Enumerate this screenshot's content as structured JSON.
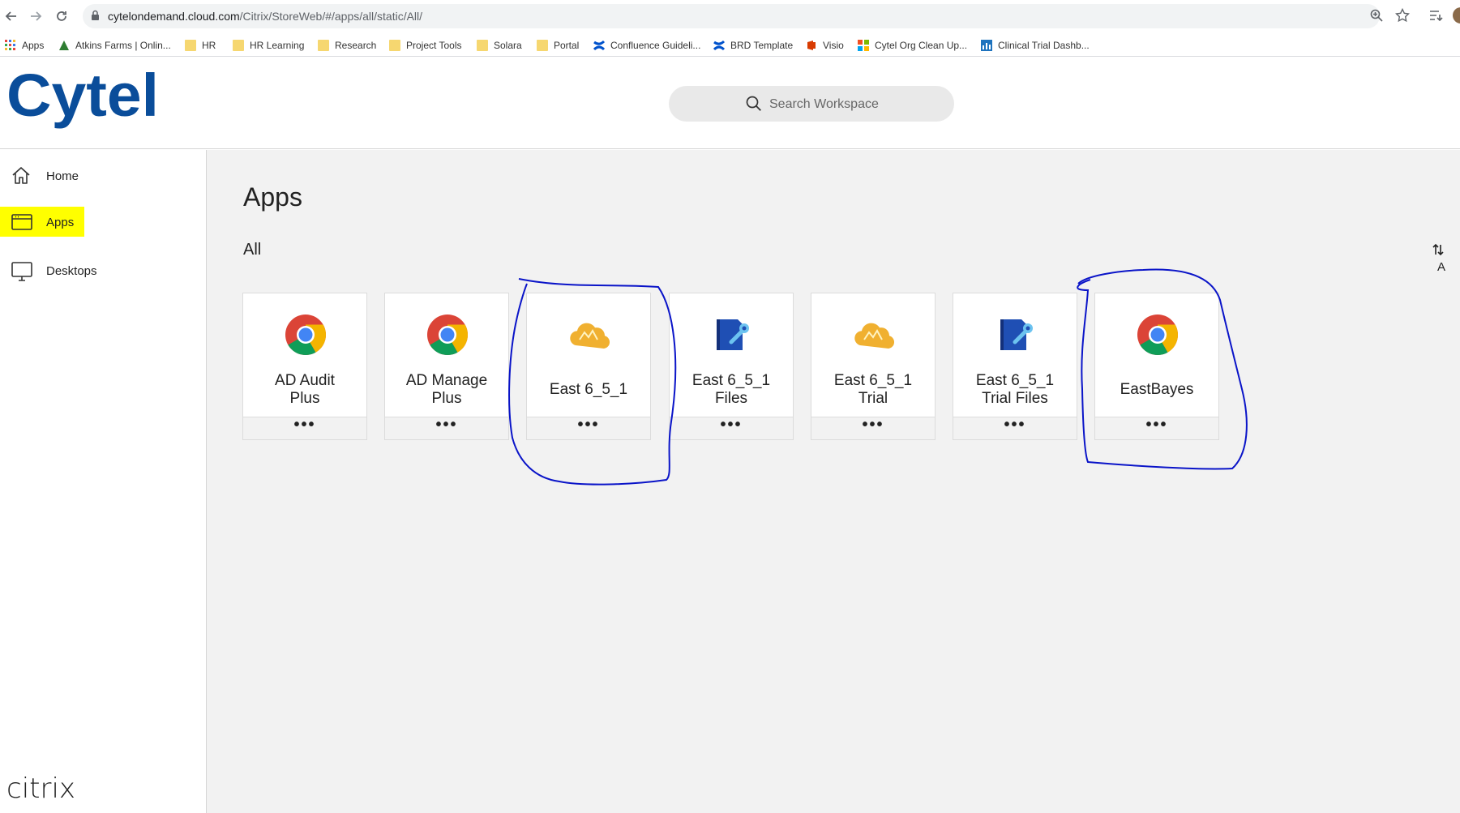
{
  "browser": {
    "url_host": "cytelondemand.cloud.com",
    "url_path": "/Citrix/StoreWeb/#/apps/all/static/All/"
  },
  "bookmarks": [
    {
      "label": "Apps",
      "icon": "apps-grid-icon"
    },
    {
      "label": "Atkins Farms | Onlin...",
      "icon": "atkins-logo-icon"
    },
    {
      "label": "HR",
      "icon": "folder-icon"
    },
    {
      "label": "HR Learning",
      "icon": "folder-icon"
    },
    {
      "label": "Research",
      "icon": "folder-icon"
    },
    {
      "label": "Project Tools",
      "icon": "folder-icon"
    },
    {
      "label": "Solara",
      "icon": "folder-icon"
    },
    {
      "label": "Portal",
      "icon": "folder-icon"
    },
    {
      "label": "Confluence Guideli...",
      "icon": "confluence-icon"
    },
    {
      "label": "BRD Template",
      "icon": "confluence-icon"
    },
    {
      "label": "Visio",
      "icon": "office-icon"
    },
    {
      "label": "Cytel Org Clean Up...",
      "icon": "microsoft-icon"
    },
    {
      "label": "Clinical Trial Dashb...",
      "icon": "chart-icon"
    }
  ],
  "header": {
    "logo_text": "Cytel",
    "search_placeholder": "Search Workspace"
  },
  "sidebar": {
    "items": [
      {
        "label": "Home",
        "icon": "home-icon"
      },
      {
        "label": "Apps",
        "icon": "apps-window-icon",
        "selected": true
      },
      {
        "label": "Desktops",
        "icon": "monitor-icon"
      }
    ],
    "footer_brand": "citrix"
  },
  "main": {
    "title": "Apps",
    "section": "All",
    "sort_label": "A",
    "apps": [
      {
        "name_line1": "AD Audit",
        "name_line2": "Plus",
        "icon": "chrome-icon",
        "more": "•••"
      },
      {
        "name_line1": "AD Manage",
        "name_line2": "Plus",
        "icon": "chrome-icon",
        "more": "•••"
      },
      {
        "name_line1": "East 6_5_1",
        "name_line2": "",
        "icon": "cloud-app-icon",
        "more": "•••"
      },
      {
        "name_line1": "East 6_5_1",
        "name_line2": "Files",
        "icon": "file-tool-icon",
        "more": "•••"
      },
      {
        "name_line1": "East 6_5_1",
        "name_line2": "Trial",
        "icon": "cloud-app-icon",
        "more": "•••"
      },
      {
        "name_line1": "East 6_5_1",
        "name_line2": "Trial Files",
        "icon": "file-tool-icon",
        "more": "•••"
      },
      {
        "name_line1": "EastBayes",
        "name_line2": "",
        "icon": "chrome-icon",
        "more": "•••"
      }
    ]
  },
  "colors": {
    "highlight": "#ffff00",
    "annotation_ink": "#0a14c8",
    "logo_blue": "#0a4d9a",
    "main_bg": "#f2f2f2"
  }
}
